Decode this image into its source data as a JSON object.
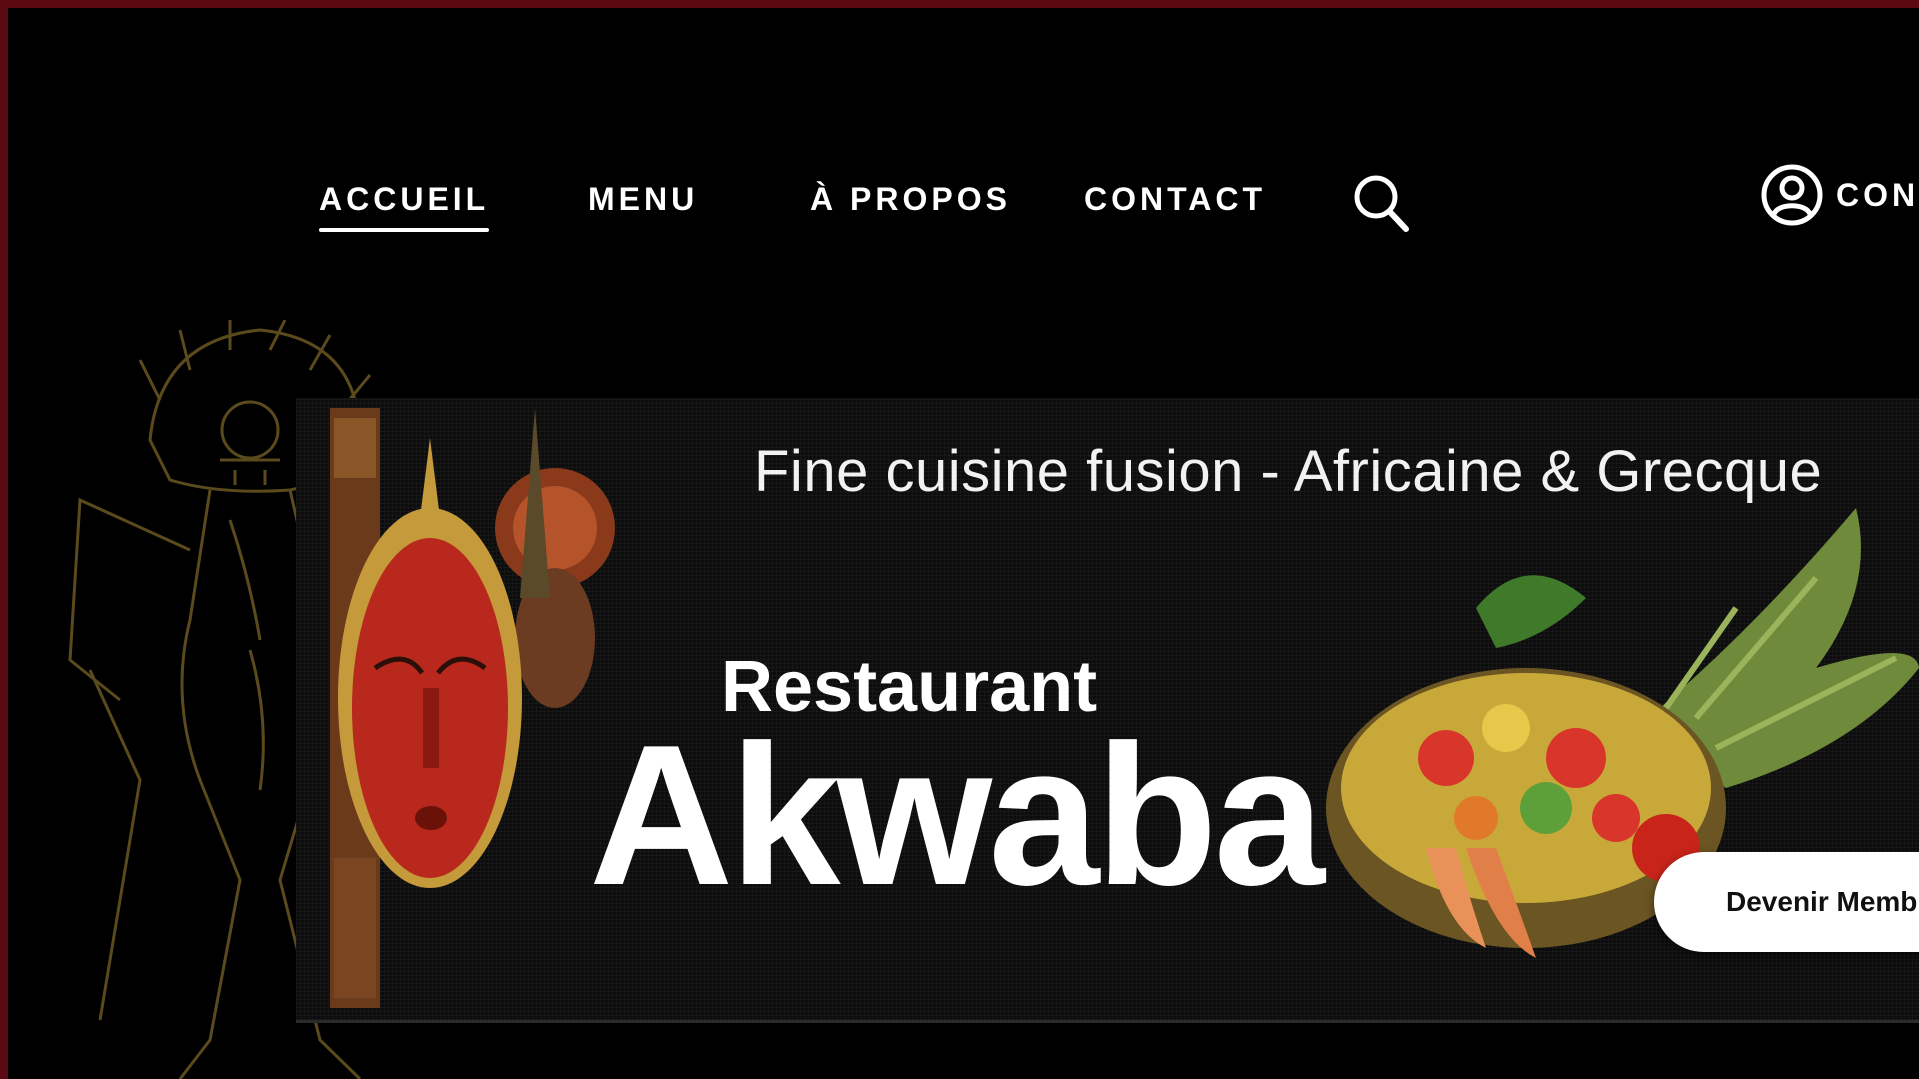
{
  "nav": {
    "items": [
      {
        "label": "ACCUEIL",
        "active": true
      },
      {
        "label": "MENU",
        "active": false
      },
      {
        "label": "À PROPOS",
        "active": false
      },
      {
        "label": "CONTACT",
        "active": false
      }
    ],
    "search_icon": "search-icon",
    "login_icon": "user-circle-icon",
    "login_label": "CONI"
  },
  "banner": {
    "tagline": "Fine cuisine fusion - Africaine & Grecque",
    "brand_small": "Restaurant",
    "brand_big": "Akwaba"
  },
  "cta": {
    "label": "Devenir Memb"
  },
  "colors": {
    "frame": "#5a0a10",
    "background": "#000000",
    "text": "#ffffff",
    "button": "#ffffff"
  }
}
